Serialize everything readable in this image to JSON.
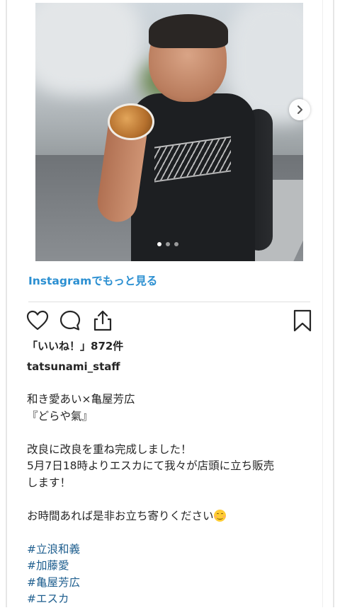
{
  "post": {
    "more_link": "Instagramでもっと見る",
    "likes": "「いいね！」872件",
    "username": "tatsunami_staff",
    "caption": {
      "line1": "和き愛あい×亀屋芳広",
      "line2": "『どらや氣』",
      "line3": "改良に改良を重ね完成しました！",
      "line4": "5月7日18時よりエスカにて我々が店頭に立ち販売",
      "line5": "します！",
      "line6": "お時間あれば是非お立ち寄りください",
      "hashtags": [
        "#立浪和義",
        "#加藤愛",
        "#亀屋芳広",
        "#エスカ"
      ]
    },
    "carousel": {
      "slide_count": 3,
      "active_index": 0
    },
    "icons": {
      "like": "heart-icon",
      "comment": "comment-icon",
      "share": "share-icon",
      "save": "bookmark-icon",
      "next": "chevron-right-icon",
      "emoji": "smiling-face-icon"
    },
    "colors": {
      "link": "#2b8fd1",
      "hashtag": "#1f5f8f",
      "text": "#262626"
    }
  }
}
